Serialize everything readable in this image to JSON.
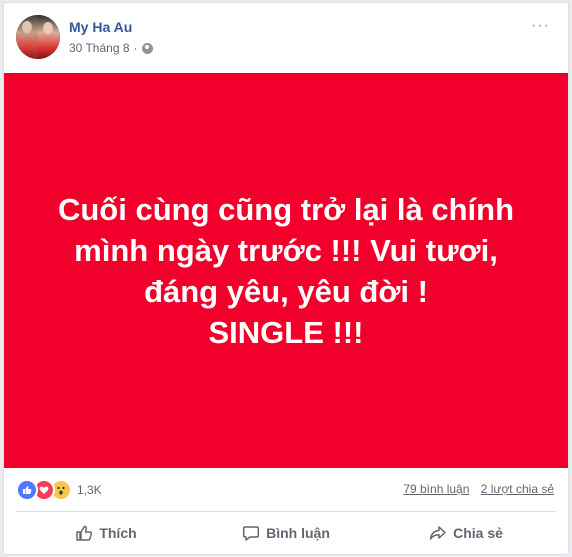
{
  "post": {
    "author": "My Ha Au",
    "date": "30 Tháng 8",
    "separator": "·",
    "more": "···",
    "banner_text": "Cuối cùng cũng trở lại là chính\nmình ngày trước !!! Vui tươi,\nđáng yêu, yêu đời !\nSINGLE !!!",
    "banner_color": "#f0002a"
  },
  "stats": {
    "reaction_icons": [
      "like-icon",
      "love-icon",
      "wow-icon"
    ],
    "reaction_count": "1,3K",
    "comments": "79 bình luận",
    "shares": "2 lượt chia sẻ"
  },
  "actions": {
    "like": "Thích",
    "comment": "Bình luận",
    "share": "Chia sẻ"
  }
}
